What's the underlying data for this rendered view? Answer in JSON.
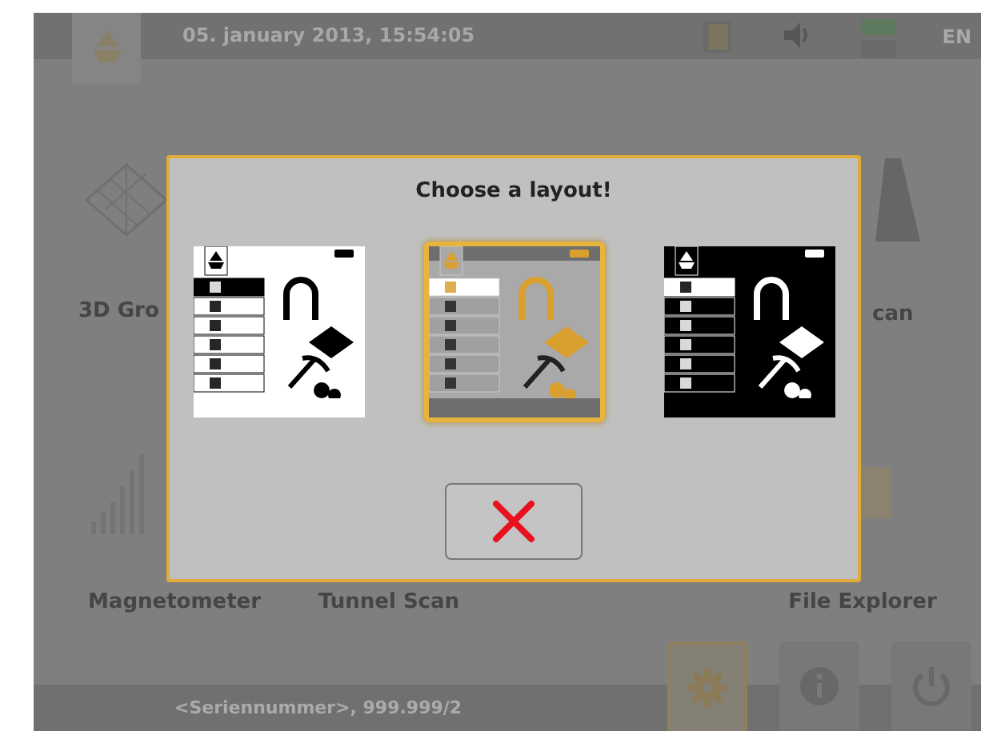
{
  "top_bar": {
    "date_time": "05. january 2013, 15:54:05",
    "language": "EN"
  },
  "apps": [
    {
      "label": "3D Gro"
    },
    {
      "label": "can"
    },
    {
      "label": "Magnetometer"
    },
    {
      "label": "Tunnel Scan"
    },
    {
      "label": "File Explorer"
    }
  ],
  "dialog": {
    "title": "Choose a layout!",
    "layouts": [
      {
        "kind": "light",
        "selected": false
      },
      {
        "kind": "gold",
        "selected": true
      },
      {
        "kind": "dark",
        "selected": false
      }
    ]
  },
  "footer": {
    "serial": "<Seriennummer>, 999.999/2"
  },
  "footer_buttons": [
    {
      "kind": "settings",
      "selected": true
    },
    {
      "kind": "info",
      "selected": false
    },
    {
      "kind": "power",
      "selected": false
    }
  ]
}
